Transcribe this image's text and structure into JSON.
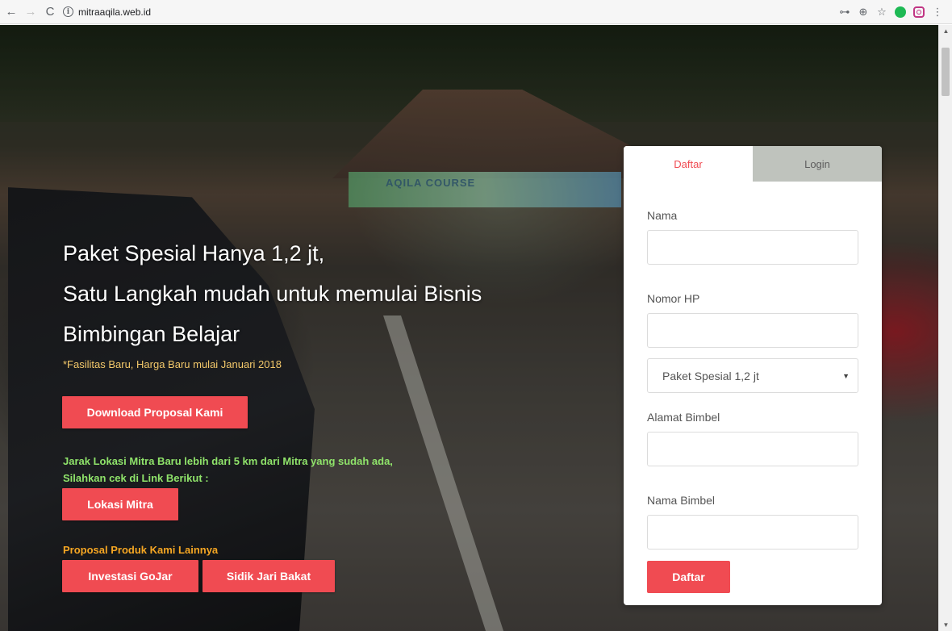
{
  "browser": {
    "url": "mitraaqila.web.id",
    "icons": [
      "back-arrow-icon",
      "forward-arrow-icon",
      "reload-icon",
      "info-icon",
      "key-icon",
      "zoom-icon",
      "star-icon",
      "chat-extension-icon",
      "instagram-extension-icon",
      "menu-dots-icon"
    ],
    "glyphs": {
      "back": "←",
      "forward": "→",
      "reload": "C",
      "info": "i",
      "key": "⊶",
      "zoom": "⊕",
      "star": "☆",
      "menu": "⋮",
      "scroll_up": "▲",
      "scroll_down": "▼"
    }
  },
  "background": {
    "sign_text": "AQILA COURSE"
  },
  "hero": {
    "headline_lines": [
      "Paket Spesial Hanya 1,2 jt,",
      "Satu Langkah mudah untuk memulai Bisnis",
      "Bimbingan Belajar"
    ],
    "sub_note": "*Fasilitas Baru, Harga Baru mulai Januari 2018",
    "download_button": "Download Proposal Kami",
    "distance_note_lines": [
      "Jarak Lokasi Mitra Baru lebih dari 5 km dari Mitra yang sudah ada,",
      "Silahkan cek di Link Berikut :"
    ],
    "lokasi_button": "Lokasi Mitra",
    "other_products_label": "Proposal Produk Kami Lainnya",
    "gojar_button": "Investasi GoJar",
    "sidik_button": "Sidik Jari Bakat"
  },
  "form": {
    "tabs": [
      {
        "label": "Daftar",
        "active": true
      },
      {
        "label": "Login",
        "active": false
      }
    ],
    "fields": {
      "nama_label": "Nama",
      "nomor_hp_label": "Nomor HP",
      "paket_selected": "Paket Spesial 1,2 jt",
      "alamat_label": "Alamat Bimbel",
      "nama_bimbel_label": "Nama Bimbel"
    },
    "submit_label": "Daftar"
  },
  "colors": {
    "accent_red": "#f04b52",
    "note_green": "#8fe36a",
    "note_orange": "#f5a623",
    "note_yellow": "#f3c86a"
  }
}
